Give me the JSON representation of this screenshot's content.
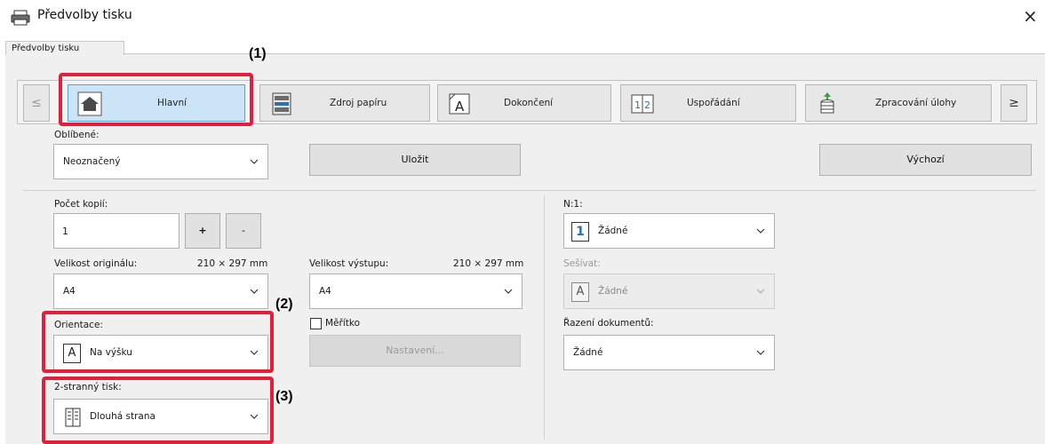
{
  "window": {
    "title": "Předvolby tisku",
    "close_label": "×"
  },
  "tab": {
    "label": "Předvolby tisku"
  },
  "toolbar": {
    "prev_arrow": "≤",
    "next_arrow": "≥",
    "items": [
      {
        "label": "Hlavní",
        "icon": "home-icon",
        "active": true
      },
      {
        "label": "Zdroj papíru",
        "icon": "paper-tray-icon",
        "active": false
      },
      {
        "label": "Dokončení",
        "icon": "finishing-icon",
        "active": false
      },
      {
        "label": "Uspořádání",
        "icon": "layout-icon",
        "active": false
      },
      {
        "label": "Zpracování úlohy",
        "icon": "job-handling-icon",
        "active": false
      }
    ]
  },
  "favorites": {
    "label": "Oblíbené:",
    "value": "Neoznačený",
    "save_label": "Uložit",
    "default_label": "Výchozí"
  },
  "copies": {
    "label": "Počet kopií:",
    "value": "1",
    "plus": "+",
    "minus": "-"
  },
  "original_size": {
    "label": "Velikost originálu:",
    "dims": "210 × 297 mm",
    "value": "A4"
  },
  "output_size": {
    "label": "Velikost výstupu:",
    "dims": "210 × 297 mm",
    "value": "A4"
  },
  "orientation": {
    "label": "Orientace:",
    "value": "Na výšku",
    "icon": "portrait-a-icon"
  },
  "scale": {
    "checkbox_label": "Měřítko",
    "settings_label": "Nastavení..."
  },
  "duplex": {
    "label": "2-stranný tisk:",
    "value": "Dlouhá strana",
    "icon": "duplex-book-icon"
  },
  "n_up": {
    "label": "N:1:",
    "value": "Žádné",
    "icon_text": "1"
  },
  "staple": {
    "label": "Sešívat:",
    "value": "Žádné",
    "icon_text": "A"
  },
  "collate": {
    "label": "Řazení dokumentů:",
    "value": "Žádné"
  },
  "annotations": [
    "(1)",
    "(2)",
    "(3)"
  ],
  "colors": {
    "highlight": "#e0203a",
    "active_tab": "#cce4f7"
  }
}
